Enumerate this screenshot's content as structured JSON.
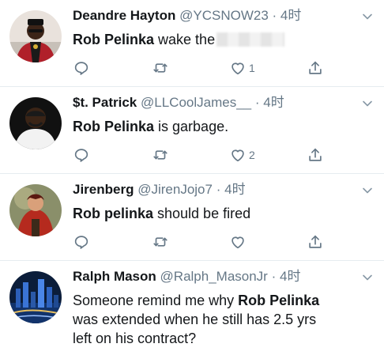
{
  "tweets": [
    {
      "name": "Deandre Hayton",
      "handle": "@YCSNOW23",
      "separator": "·",
      "time": "4时",
      "text_bold": "Rob Pelinka",
      "text_rest": " wake the",
      "like_count": "1",
      "avatar_icon": "person-red-jacket-avatar"
    },
    {
      "name": "$t. Patrick",
      "handle": "@LLCoolJames__",
      "separator": "·",
      "time": "4时",
      "text_bold": "Rob Pelinka",
      "text_rest": " is garbage.",
      "like_count": "2",
      "avatar_icon": "person-white-shirt-avatar"
    },
    {
      "name": "Jirenberg",
      "handle": "@JirenJojo7",
      "separator": "·",
      "time": "4时",
      "text_bold": "Rob pelinka",
      "text_rest": " should be fired",
      "like_count": "",
      "avatar_icon": "anime-character-avatar"
    },
    {
      "name": "Ralph Mason",
      "handle": "@Ralph_MasonJr",
      "separator": "·",
      "time": "4时",
      "text_before": "Someone remind me why ",
      "text_bold": "Rob Pelinka",
      "text_line2": "was extended when he still has 2.5 yrs",
      "text_line3": "left on his contract?",
      "avatar_icon": "city-night-avatar"
    }
  ],
  "colors": {
    "name": "#14171a",
    "secondary": "#657786",
    "divider": "#e6ecf0",
    "icon": "#657786"
  }
}
